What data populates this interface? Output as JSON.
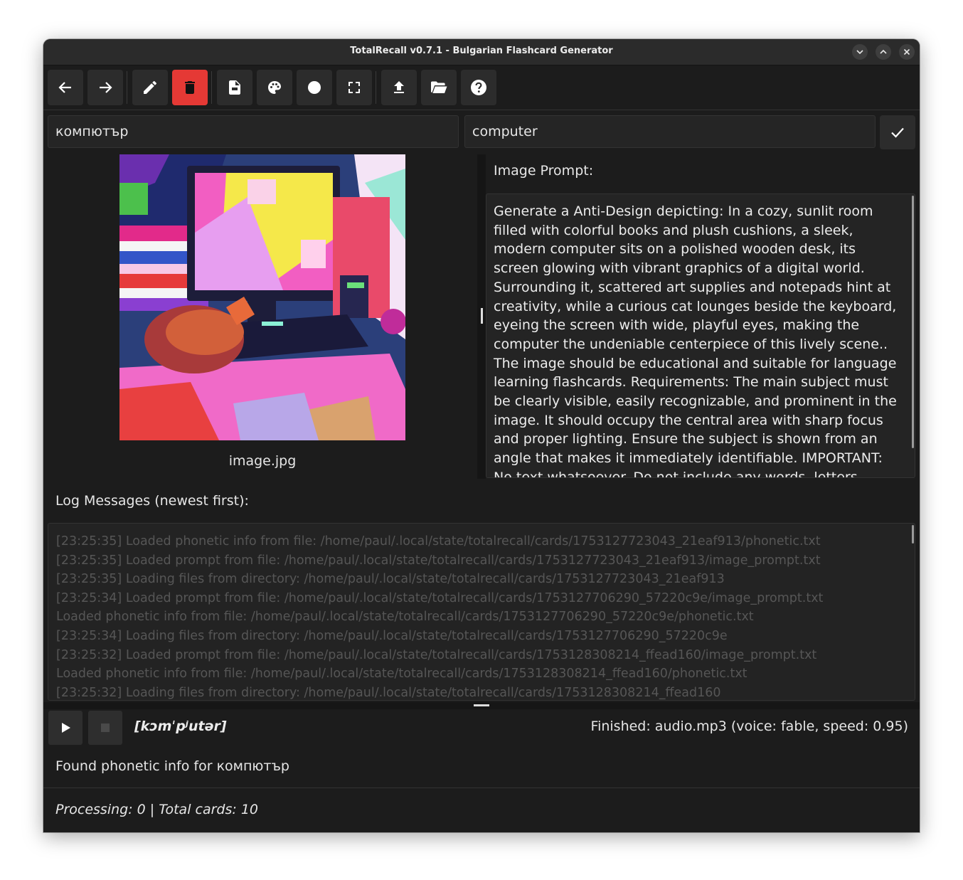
{
  "window": {
    "title": "TotalRecall v0.7.1 - Bulgarian Flashcard Generator",
    "controls": [
      "minimize",
      "maximize",
      "close"
    ]
  },
  "toolbar": {
    "buttons": [
      {
        "icon": "arrow-left-icon",
        "name": "back-button"
      },
      {
        "icon": "arrow-right-icon",
        "name": "forward-button"
      },
      {
        "icon": "pencil-icon",
        "name": "edit-button"
      },
      {
        "icon": "trash-icon",
        "name": "delete-button",
        "color": "#e53935"
      },
      {
        "icon": "file-icon",
        "name": "new-file-button"
      },
      {
        "icon": "palette-icon",
        "name": "palette-button"
      },
      {
        "icon": "circle-icon",
        "name": "record-button"
      },
      {
        "icon": "fullscreen-icon",
        "name": "fullscreen-button"
      },
      {
        "icon": "upload-icon",
        "name": "upload-button"
      },
      {
        "icon": "folder-open-icon",
        "name": "open-folder-button"
      },
      {
        "icon": "help-icon",
        "name": "help-button"
      }
    ]
  },
  "word": {
    "bulgarian": "компютър",
    "english": "computer"
  },
  "image": {
    "filename": "image.jpg"
  },
  "prompt": {
    "label": "Image Prompt:",
    "text": "Generate a Anti-Design depicting: In a cozy, sunlit room filled with colorful books and plush cushions, a sleek, modern computer sits on a polished wooden desk, its screen glowing with vibrant graphics of a digital world. Surrounding it, scattered art supplies and notepads hint at creativity, while a curious cat lounges beside the keyboard, eyeing the screen with wide, playful eyes, making the computer the undeniable centerpiece of this lively scene.. The image should be educational and suitable for language learning flashcards. Requirements: The main subject must be clearly visible, easily recognizable, and prominent in the image. It should occupy the central area with sharp focus and proper lighting. Ensure the subject is shown from an angle that makes it immediately identifiable. IMPORTANT: No text whatsoever. Do not include any words, letters, typography, labels, captions, or writing of"
  },
  "log": {
    "label": "Log Messages (newest first):",
    "lines": [
      "[23:25:35] Loaded phonetic info from file: /home/paul/.local/state/totalrecall/cards/1753127723043_21eaf913/phonetic.txt",
      "[23:25:35] Loaded prompt from file: /home/paul/.local/state/totalrecall/cards/1753127723043_21eaf913/image_prompt.txt",
      "[23:25:35] Loading files from directory: /home/paul/.local/state/totalrecall/cards/1753127723043_21eaf913",
      "[23:25:34] Loaded prompt from file: /home/paul/.local/state/totalrecall/cards/1753127706290_57220c9e/image_prompt.txt",
      "Loaded phonetic info from file: /home/paul/.local/state/totalrecall/cards/1753127706290_57220c9e/phonetic.txt",
      "[23:25:34] Loading files from directory: /home/paul/.local/state/totalrecall/cards/1753127706290_57220c9e",
      "[23:25:32] Loaded prompt from file: /home/paul/.local/state/totalrecall/cards/1753128308214_ffead160/image_prompt.txt",
      "Loaded phonetic info from file: /home/paul/.local/state/totalrecall/cards/1753128308214_ffead160/phonetic.txt",
      "[23:25:32] Loading files from directory: /home/paul/.local/state/totalrecall/cards/1753128308214_ffead160"
    ]
  },
  "audio": {
    "phonetic": "[kɔmˈpʲutər]",
    "status": "Finished: audio.mp3 (voice: fable, speed: 0.95)"
  },
  "status_message": "Found phonetic info for компютър",
  "footer": "Processing: 0 | Total cards: 10"
}
